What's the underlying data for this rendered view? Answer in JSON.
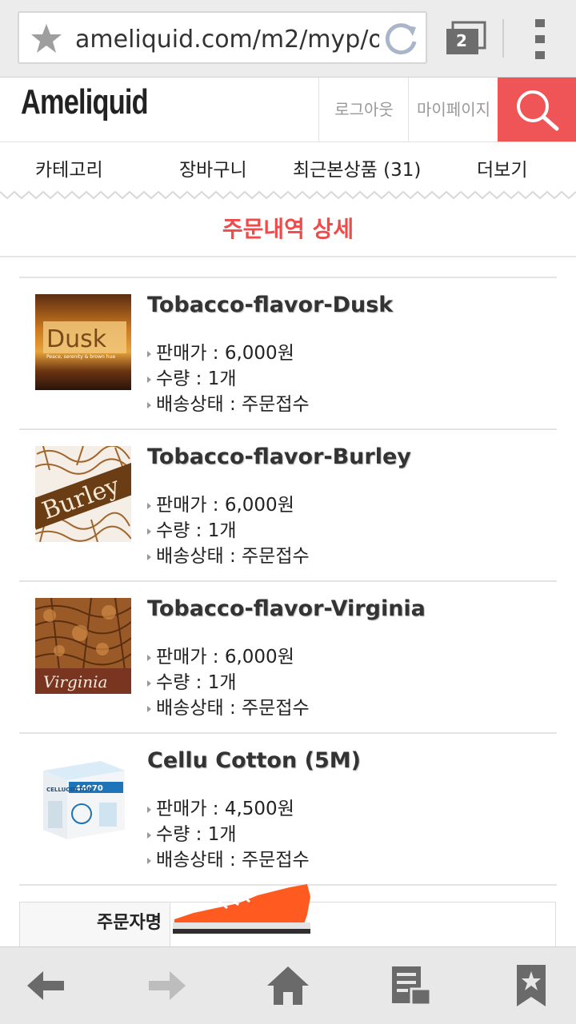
{
  "browser": {
    "url": "ameliquid.com/m2/myp/o",
    "tab_count": "2"
  },
  "header": {
    "logo": "Ameliquid",
    "logout": "로그아웃",
    "mypage": "마이페이지"
  },
  "nav": {
    "category": "카테고리",
    "cart": "장바구니",
    "recent": "최근본상품 (31)",
    "more": "더보기"
  },
  "page_title": "주문내역 상세",
  "products": [
    {
      "name": "Tobacco-flavor-Dusk",
      "price": "판매가 : 6,000원",
      "qty": "수량 : 1개",
      "status": "배송상태 : 주문접수",
      "thumb_text": "Dusk",
      "thumb_sub": "Peace, serenity & brown hue"
    },
    {
      "name": "Tobacco-flavor-Burley",
      "price": "판매가 : 6,000원",
      "qty": "수량 : 1개",
      "status": "배송상태 : 주문접수",
      "thumb_text": "Burley"
    },
    {
      "name": "Tobacco-flavor-Virginia",
      "price": "판매가 : 6,000원",
      "qty": "수량 : 1개",
      "status": "배송상태 : 주문접수",
      "thumb_text": "Virginia"
    },
    {
      "name": "Cellu Cotton (5M)",
      "price": "판매가 : 4,500원",
      "qty": "수량 : 1개",
      "status": "배송상태 : 주문접수",
      "thumb_text": "CELLUCOTTON",
      "thumb_num": "44070"
    }
  ],
  "orderer_label": "주문자명",
  "colors": {
    "accent": "#ef5456",
    "title": "#ef4b4b"
  }
}
